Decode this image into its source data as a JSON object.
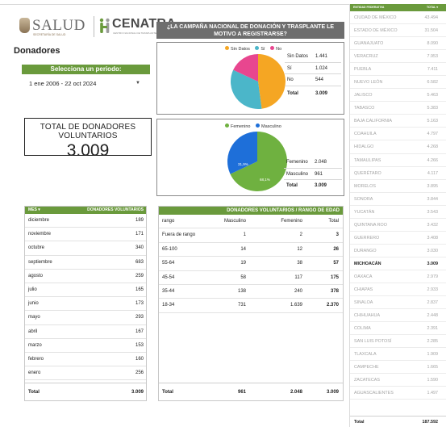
{
  "header": {
    "salud_word": "SALUD",
    "salud_sub": "SECRETARÍA DE SALUD",
    "cenatra_word": "CENATRA",
    "cenatra_sub": "CENTRO NACIONAL DE TRASPLANTES"
  },
  "colors": {
    "accent_green": "#6a9a3c",
    "header_gray": "#6e6e6e",
    "pie_orange": "#f5a623",
    "pie_teal": "#4bb6c9",
    "pie_pink": "#e8468f",
    "pie_green": "#6fb140",
    "pie_blue": "#1e6fd9"
  },
  "section_title": "Donadores",
  "period": {
    "label": "Selecciona un periodo:",
    "value": "1 ene 2006 - 22 oct 2024"
  },
  "total_card": {
    "label": "TOTAL DE DONADORES VOLUNTARIOS",
    "value": "3.009"
  },
  "campaign": {
    "question": "¿LA CAMPAÑA NACIONAL DE DONACIÓN Y TRASPLANTE LE MOTIVO A REGISTRARSE?",
    "legend": [
      "Sin Datos",
      "Sí",
      "No"
    ],
    "rows": [
      {
        "label": "Sin Datos",
        "value": "1.441"
      },
      {
        "label": "Sí",
        "value": "1.024"
      },
      {
        "label": "No",
        "value": "544"
      }
    ],
    "total_label": "Total",
    "total_value": "3.009"
  },
  "gender": {
    "legend": [
      "Femenino",
      "Masculino"
    ],
    "pct_labels": [
      "31,9%",
      "68,1%"
    ],
    "rows": [
      {
        "label": "Femenino",
        "value": "2.048"
      },
      {
        "label": "Masculino",
        "value": "961"
      }
    ],
    "total_label": "Total",
    "total_value": "3.009"
  },
  "months": {
    "col_mes": "MES ▾",
    "col_val": "DONADORES VOLUNTARIOS",
    "rows": [
      {
        "mes": "diciembre",
        "val": "189"
      },
      {
        "mes": "noviembre",
        "val": "171"
      },
      {
        "mes": "octubre",
        "val": "340"
      },
      {
        "mes": "septiembre",
        "val": "683"
      },
      {
        "mes": "agosto",
        "val": "259"
      },
      {
        "mes": "julio",
        "val": "165"
      },
      {
        "mes": "junio",
        "val": "173"
      },
      {
        "mes": "mayo",
        "val": "293"
      },
      {
        "mes": "abril",
        "val": "167"
      },
      {
        "mes": "marzo",
        "val": "153"
      },
      {
        "mes": "febrero",
        "val": "160"
      },
      {
        "mes": "enero",
        "val": "256"
      }
    ],
    "total_label": "Total",
    "total_value": "3.009"
  },
  "ranges": {
    "title": "DONADORES VOLUNTARIOS / RANGO DE EDAD",
    "headers": [
      "rango",
      "Masculino",
      "Femenino",
      "Total"
    ],
    "rows": [
      {
        "r": "Fuera de rango",
        "m": "1",
        "f": "2",
        "t": "3"
      },
      {
        "r": "65-100",
        "m": "14",
        "f": "12",
        "t": "26"
      },
      {
        "r": "55-64",
        "m": "19",
        "f": "38",
        "t": "57"
      },
      {
        "r": "45-54",
        "m": "58",
        "f": "117",
        "t": "175"
      },
      {
        "r": "35-44",
        "m": "138",
        "f": "240",
        "t": "378"
      },
      {
        "r": "18-34",
        "m": "731",
        "f": "1.639",
        "t": "2.370"
      }
    ],
    "total": {
      "r": "Total",
      "m": "961",
      "f": "2.048",
      "t": "3.009"
    }
  },
  "states": {
    "col_a": "ENTIDAD FEDERATIVA",
    "col_b": "TOTAL ▾",
    "rows": [
      {
        "name": "CIUDAD DE MÉXICO",
        "val": "43.494"
      },
      {
        "name": "ESTADO DE MÉXICO",
        "val": "31.504"
      },
      {
        "name": "GUANAJUATO",
        "val": "8.090"
      },
      {
        "name": "VERACRUZ",
        "val": "7.953"
      },
      {
        "name": "PUEBLA",
        "val": "7.411"
      },
      {
        "name": "NUEVO LEÓN",
        "val": "6.582"
      },
      {
        "name": "JALISCO",
        "val": "5.463"
      },
      {
        "name": "TABASCO",
        "val": "5.383"
      },
      {
        "name": "BAJA CALIFORNIA",
        "val": "5.163"
      },
      {
        "name": "COAHUILA",
        "val": "4.797"
      },
      {
        "name": "HIDALGO",
        "val": "4.268"
      },
      {
        "name": "TAMAULIPAS",
        "val": "4.266"
      },
      {
        "name": "QUERÉTARO",
        "val": "4.117"
      },
      {
        "name": "MORELOS",
        "val": "3.895"
      },
      {
        "name": "SONORA",
        "val": "3.844"
      },
      {
        "name": "YUCATÁN",
        "val": "3.543"
      },
      {
        "name": "QUINTANA ROO",
        "val": "3.432"
      },
      {
        "name": "GUERRERO",
        "val": "3.408"
      },
      {
        "name": "DURANGO",
        "val": "3.030"
      },
      {
        "name": "MICHOACÁN",
        "val": "3.009",
        "highlight": true
      },
      {
        "name": "OAXACA",
        "val": "2.979"
      },
      {
        "name": "CHIAPAS",
        "val": "2.933"
      },
      {
        "name": "SINALOA",
        "val": "2.837"
      },
      {
        "name": "CHIHUAHUA",
        "val": "2.448"
      },
      {
        "name": "COLIMA",
        "val": "2.391"
      },
      {
        "name": "SAN LUIS POTOSÍ",
        "val": "2.285"
      },
      {
        "name": "TLAXCALA",
        "val": "1.909"
      },
      {
        "name": "CAMPECHE",
        "val": "1.665"
      },
      {
        "name": "ZACATECAS",
        "val": "1.590"
      },
      {
        "name": "AGUASCALIENTES",
        "val": "1.497"
      }
    ],
    "total_label": "Total",
    "total_value": "187.592"
  }
}
